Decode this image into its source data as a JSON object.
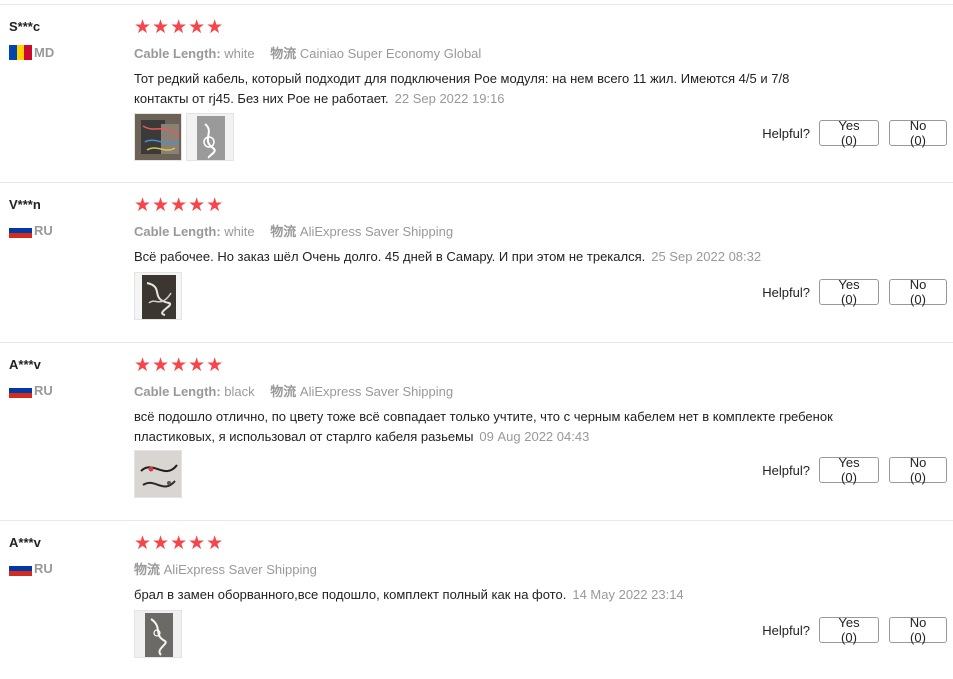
{
  "helpful_label": "Helpful?",
  "reviews": [
    {
      "user": "S***c",
      "country": "MD",
      "stars": "★★★★★",
      "sku_label": "Cable Length:",
      "sku_value": "white",
      "shipping_label": "物流",
      "shipping_value": "Cainiao Super Economy Global",
      "text": "Тот редкий кабель, который подходит для подключения Poe модуля: на нем всего 11 жил. Имеются 4/5 и 7/8 контакты от rj45. Без них Poe не работает.",
      "date": "22 Sep 2022 19:16",
      "yes": "Yes (0)",
      "no": "No (0)"
    },
    {
      "user": "V***n",
      "country": "RU",
      "stars": "★★★★★",
      "sku_label": "Cable Length:",
      "sku_value": "white",
      "shipping_label": "物流",
      "shipping_value": "AliExpress Saver Shipping",
      "text": "Всё рабочее. Но заказ шёл Очень долго. 45 дней в Самару. И при этом не трекался.",
      "date": "25 Sep 2022 08:32",
      "yes": "Yes (0)",
      "no": "No (0)"
    },
    {
      "user": "A***v",
      "country": "RU",
      "stars": "★★★★★",
      "sku_label": "Cable Length:",
      "sku_value": "black",
      "shipping_label": "物流",
      "shipping_value": "AliExpress Saver Shipping",
      "text": "всё подошло отлично, по цвету тоже всё совпадает только учтите, что с черным кабелем нет в комплекте гребенок пластиковых, я использовал от старлго кабеля разьемы",
      "date": "09 Aug 2022 04:43",
      "yes": "Yes (0)",
      "no": "No (0)"
    },
    {
      "user": "A***v",
      "country": "RU",
      "stars": "★★★★★",
      "shipping_label": "物流",
      "shipping_value": "AliExpress Saver Shipping",
      "text": "брал в замен оборванного,все подошло, комплект полный как на фото.",
      "date": "14 May 2022 23:14",
      "yes": "Yes (0)",
      "no": "No (0)"
    }
  ],
  "colors": {
    "star": "#f5474b",
    "muted": "#999999",
    "divider": "#e8e8e8"
  }
}
